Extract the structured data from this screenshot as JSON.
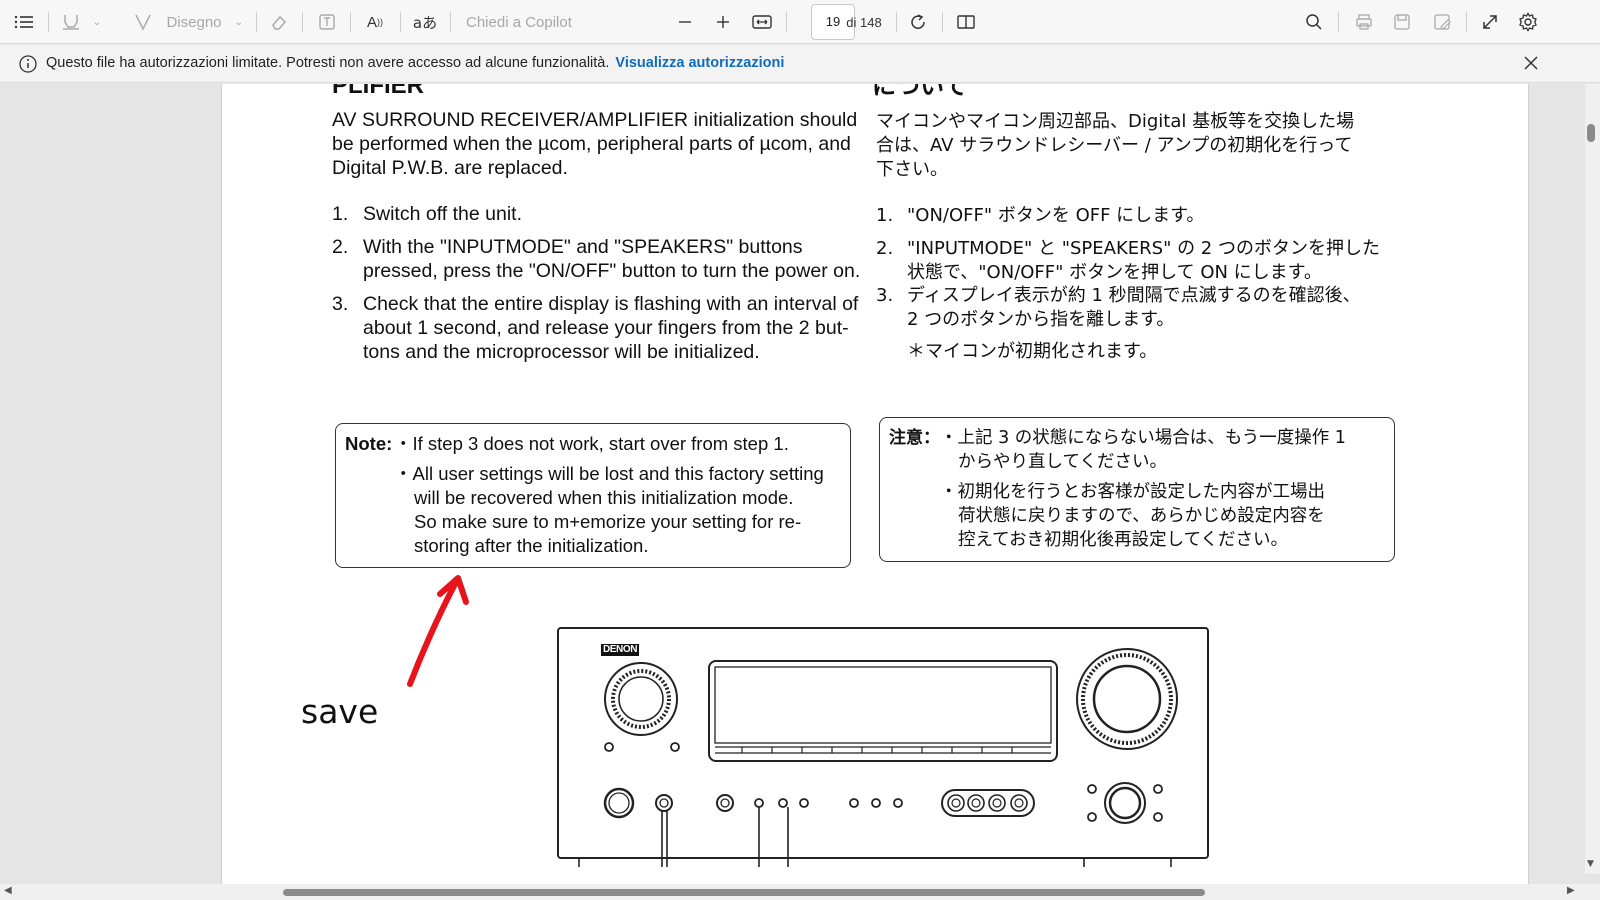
{
  "toolbar": {
    "draw_label": "Disegno",
    "copilot_label": "Chiedi a Copilot",
    "page_number": "19",
    "page_total": "di 148"
  },
  "infobar": {
    "message": "Questo file ha autorizzazioni limitate. Potresti non avere accesso ad alcune funzionalità.",
    "link": "Visualizza autorizzazioni"
  },
  "document": {
    "en_heading_partial": "PLIFIER",
    "jp_heading_partial": "について",
    "en_intro": [
      "AV SURROUND RECEIVER/AMPLIFIER initialization should",
      "be performed when the µcom, peripheral parts of µcom, and",
      "Digital P.W.B. are replaced."
    ],
    "en_steps": [
      {
        "num": "1.",
        "lines": [
          "Switch off the unit."
        ]
      },
      {
        "num": "2.",
        "lines": [
          "With the \"INPUTMODE\" and \"SPEAKERS\" buttons",
          "pressed, press the \"ON/OFF\" button to turn the power on."
        ]
      },
      {
        "num": "3.",
        "lines": [
          "Check that the entire display is flashing with an interval of",
          "about 1 second, and release your fingers from the 2 but-",
          "tons and the microprocessor will be initialized."
        ]
      }
    ],
    "jp_intro": [
      "マイコンやマイコン周辺部品、Digital 基板等を交換した場",
      "合は、AV サラウンドレシーバー / アンプの初期化を行って",
      "下さい。"
    ],
    "jp_steps": [
      {
        "num": "1.",
        "lines": [
          "\"ON/OFF\" ボタンを OFF にします。"
        ]
      },
      {
        "num": "2.",
        "lines": [
          "\"INPUTMODE\" と \"SPEAKERS\" の 2 つのボタンを押した",
          "状態で、\"ON/OFF\" ボタンを押して ON にします。"
        ]
      },
      {
        "num": "3.",
        "lines": [
          "ディスプレイ表示が約 1 秒間隔で点滅するのを確認後、",
          "2 つのボタンから指を離します。"
        ]
      }
    ],
    "jp_step_note": "＊マイコンが初期化されます。",
    "en_note_label": "Note:",
    "en_note_lines": [
      "・If step 3 does not work, start over from step 1.",
      "・All user settings will be lost and this factory setting",
      "will be recovered when this initialization mode.",
      "So make sure to m+emorize your setting for re-",
      "storing after the initialization."
    ],
    "jp_note_label": "注意：",
    "jp_note_lines": [
      "・上記 3 の状態にならない場合は、もう一度操作 1",
      "からやり直してください。",
      "・初期化を行うとお客様が設定した内容が工場出",
      "荷状態に戻りますので、あらかじめ設定内容を",
      "控えておき初期化後再設定してください。"
    ],
    "annotation_text": "save",
    "brand": "DENON"
  },
  "colors": {
    "link": "#0f6cbd",
    "annotation": "#e8141c"
  },
  "icons": [
    "list-icon",
    "highlighter-icon",
    "draw-icon",
    "eraser-icon",
    "textbox-icon",
    "read-aloud-icon",
    "translate-icon",
    "zoom-out-icon",
    "zoom-in-icon",
    "fit-width-icon",
    "rotate-icon",
    "page-view-icon",
    "search-icon",
    "print-icon",
    "save-icon",
    "save-as-icon",
    "fullscreen-icon",
    "settings-icon",
    "info-icon",
    "close-icon"
  ]
}
